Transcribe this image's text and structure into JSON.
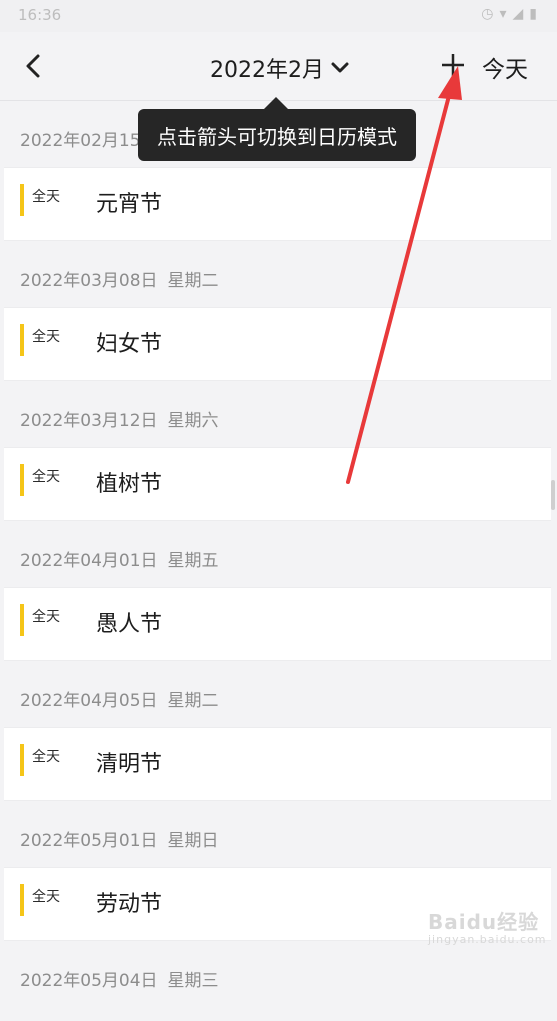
{
  "status_bar": {
    "time": "16:36",
    "icons": [
      "signal-speed",
      "alarm-icon",
      "wifi-icon",
      "cell-signal-icon",
      "battery-icon"
    ]
  },
  "header": {
    "month_label": "2022年2月",
    "today_label": "今天"
  },
  "tooltip": {
    "text": "点击箭头可切换到日历模式"
  },
  "accent_color": "#f5c518",
  "annotation_arrow_color": "#e8393a",
  "events": [
    {
      "date": "2022年02月15",
      "weekday": "",
      "all_day": "全天",
      "title": "元宵节"
    },
    {
      "date": "2022年03月08日",
      "weekday": "星期二",
      "all_day": "全天",
      "title": "妇女节"
    },
    {
      "date": "2022年03月12日",
      "weekday": "星期六",
      "all_day": "全天",
      "title": "植树节"
    },
    {
      "date": "2022年04月01日",
      "weekday": "星期五",
      "all_day": "全天",
      "title": "愚人节"
    },
    {
      "date": "2022年04月05日",
      "weekday": "星期二",
      "all_day": "全天",
      "title": "清明节"
    },
    {
      "date": "2022年05月01日",
      "weekday": "星期日",
      "all_day": "全天",
      "title": "劳动节"
    },
    {
      "date": "2022年05月04日",
      "weekday": "星期三",
      "all_day": "",
      "title": ""
    }
  ],
  "watermark": {
    "brand": "Baidu经验",
    "url": "jingyan.baidu.com"
  }
}
